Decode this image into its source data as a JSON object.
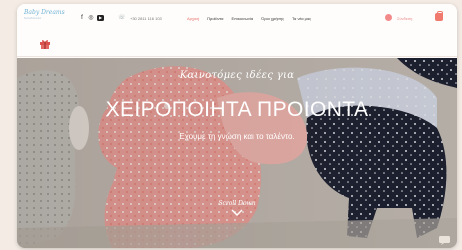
{
  "header": {
    "logo_text": "Baby Dreams",
    "logo_sub": "handmade",
    "social_icons": [
      "facebook-icon",
      "instagram-icon",
      "youtube-icon"
    ],
    "phone": "+30 2811 116 103",
    "nav": [
      {
        "label": "Αρχική",
        "active": true
      },
      {
        "label": "Προϊόντα",
        "active": false
      },
      {
        "label": "Επικοινωνία",
        "active": false
      },
      {
        "label": "Όροι χρήσης",
        "active": false
      },
      {
        "label": "Τα νέα μας",
        "active": false
      }
    ],
    "account_label": "Σύνδεση"
  },
  "hero": {
    "subtitle": "Καινοτόμες ιδέες για",
    "title": "ΧΕΙΡΟΠΟΙΗΤΑ ΠΡΟΙΟΝΤΑ",
    "description": "Εχουμε τη γνώση και το ταλέντο.",
    "scroll_label": "Scroll Down"
  },
  "colors": {
    "accent": "#e8706a",
    "logo": "#6fb3d6",
    "pink_fabric": "#f4a7a0",
    "navy_fabric": "#1f2233"
  }
}
